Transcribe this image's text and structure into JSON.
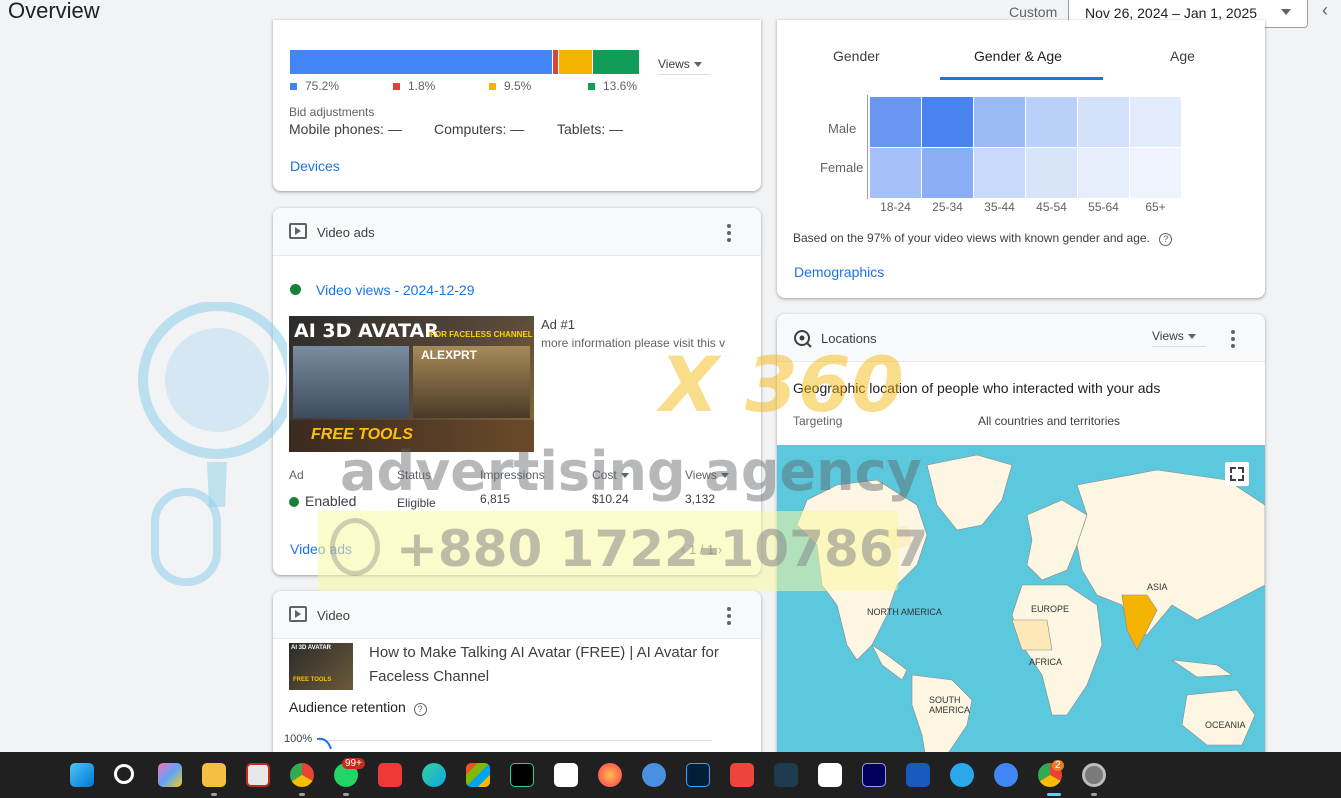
{
  "header": {
    "title": "Overview",
    "custom_label": "Custom",
    "date_range": "Nov 26, 2024 – Jan 1, 2025"
  },
  "devices": {
    "segments": [
      {
        "pct": 75.2,
        "label": "75.2%",
        "color": "#4285f4"
      },
      {
        "pct": 1.8,
        "label": "1.8%",
        "color": "#db4437"
      },
      {
        "pct": 9.5,
        "label": "9.5%",
        "color": "#f4b400"
      },
      {
        "pct": 13.6,
        "label": "13.6%",
        "color": "#0f9d58"
      }
    ],
    "metric_dropdown": "Views",
    "bid_title": "Bid adjustments",
    "bid_mobile": "Mobile phones: —",
    "bid_computers": "Computers: —",
    "bid_tablets": "Tablets: —",
    "link": "Devices"
  },
  "video_ads": {
    "title": "Video ads",
    "campaign": "Video views - 2024-12-29",
    "ad_number": "Ad #1",
    "ad_desc": "more information please visit this v",
    "thumb_title": "AI 3D AVATAR",
    "thumb_sub": "FOR FACELESS CHANNEL",
    "thumb_brand": "ALEXPRT",
    "thumb_bottom": "FREE TOOLS",
    "columns": [
      "Ad",
      "Status",
      "Impressions",
      "Cost",
      "Views"
    ],
    "row": {
      "ad": "Enabled",
      "status": "Eligible",
      "impressions": "6,815",
      "cost": "$10.24",
      "views": "3,132"
    },
    "link": "Video ads",
    "pager": "1 / 1"
  },
  "video": {
    "title": "Video",
    "video_title": "How to Make Talking AI Avatar (FREE) | AI Avatar for Faceless Channel",
    "thumb_title": "AI 3D AVATAR",
    "thumb_bottom": "FREE TOOLS",
    "retention_label": "Audience retention",
    "retention_axis": "100%"
  },
  "demographics": {
    "tabs": [
      "Gender",
      "Gender & Age",
      "Age"
    ],
    "active_tab": "Gender & Age",
    "rows": [
      "Male",
      "Female"
    ],
    "age_groups": [
      "18-24",
      "25-34",
      "35-44",
      "45-54",
      "55-64",
      "65+"
    ],
    "heat_colors": [
      [
        "#6996f1",
        "#4a82f0",
        "#9ab9f5",
        "#bad0f8",
        "#d3e1fa",
        "#e2ebfb"
      ],
      [
        "#a4c0f6",
        "#8aaef4",
        "#c8d9f9",
        "#d8e4fa",
        "#e6eefc",
        "#eef3fd"
      ]
    ],
    "note": "Based on the 97% of your video views with known gender and age.",
    "link": "Demographics"
  },
  "locations": {
    "title": "Locations",
    "metric_dropdown": "Views",
    "heading": "Geographic location of people who interacted with your ads",
    "targeting_label": "Targeting",
    "targeting_value": "All countries and territories",
    "map_labels": [
      "NORTH AMERICA",
      "EUROPE",
      "ASIA",
      "AFRICA",
      "SOUTH AMERICA",
      "OCEANIA"
    ]
  },
  "watermark": {
    "brand": "X 360",
    "tagline": "advertising agency",
    "phone": "+880 1722-107867"
  },
  "taskbar": {
    "whatsapp_badge": "99+",
    "chrome_badge": "2",
    "icons": [
      "start-icon",
      "search-icon",
      "copilot-icon",
      "file-explorer-icon",
      "snipping-tool-icon",
      "chrome-icon",
      "whatsapp-icon",
      "vivaldi-icon",
      "edge-icon",
      "store-icon",
      "pycharm-icon",
      "capcut-icon",
      "firefox-icon",
      "sync-icon",
      "photoshop-icon",
      "anydesk-icon",
      "terminal-icon",
      "capcut-pro-icon",
      "premiere-icon",
      "word-icon",
      "telegram-icon",
      "translate-icon",
      "chrome-profile-icon",
      "settings-icon"
    ]
  }
}
